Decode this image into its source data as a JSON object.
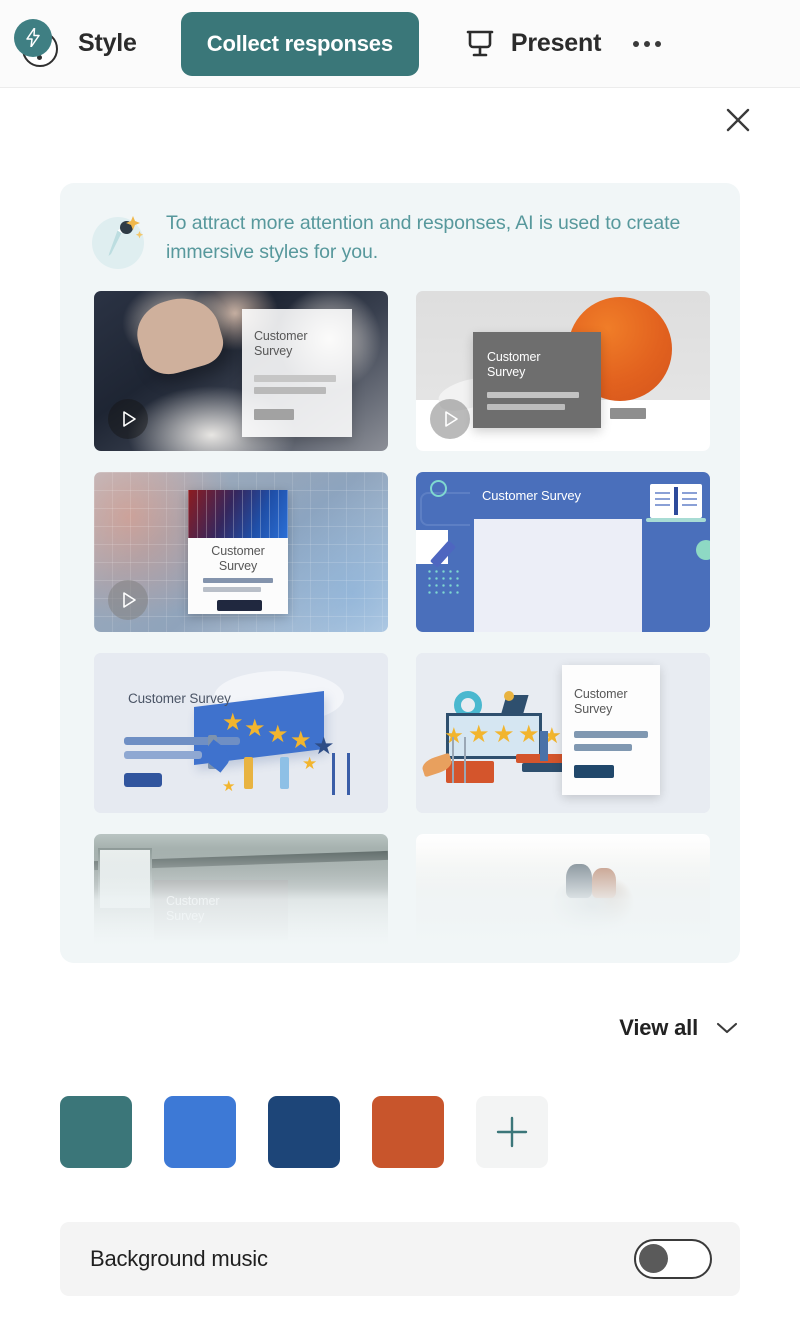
{
  "header": {
    "logo_icon": "style-bolt-logo-icon",
    "style_label": "Style",
    "collect_label": "Collect responses",
    "present_icon": "projector-screen-icon",
    "present_label": "Present",
    "more_icon": "more-horizontal-icon"
  },
  "close_icon": "close-icon",
  "ai_banner": {
    "icon": "magic-paintbrush-icon",
    "text": "To attract more attention and responses, AI is used to create immersive styles for you."
  },
  "styles": [
    {
      "name": "business-meeting-photo-style",
      "card_title": "Customer\nSurvey",
      "has_video": true,
      "play_icon": "play-icon"
    },
    {
      "name": "orange-sun-minimal-style",
      "card_title": "Customer\nSurvey",
      "has_video": true,
      "play_icon": "play-icon"
    },
    {
      "name": "data-technology-photo-style",
      "card_title": "Customer\nSurvey",
      "has_video": true,
      "play_icon": "play-icon"
    },
    {
      "name": "blue-illustrated-office-style",
      "card_title": "Customer Survey",
      "has_video": false
    },
    {
      "name": "star-rating-illustration-style",
      "card_title": "Customer Survey",
      "has_video": false
    },
    {
      "name": "monitor-review-illustration-style",
      "card_title": "Customer\nSurvey",
      "has_video": false
    },
    {
      "name": "industrial-interior-photo-style",
      "card_title": "",
      "has_video": false
    },
    {
      "name": "people-car-photo-style",
      "card_title": "",
      "has_video": false
    }
  ],
  "view_all": {
    "label": "View all",
    "icon": "chevron-down-icon"
  },
  "swatches": {
    "colors": [
      "#3b7679",
      "#3d79d6",
      "#1d4578",
      "#c8552c"
    ],
    "add_icon": "plus-icon",
    "add_icon_color": "#3b7679",
    "selected_index": 0
  },
  "background_music": {
    "label": "Background music",
    "enabled": false
  },
  "theme": {
    "accent": "#3a7779",
    "panel_bg": "#f1f6f7",
    "banner_text_color": "#57989c"
  }
}
